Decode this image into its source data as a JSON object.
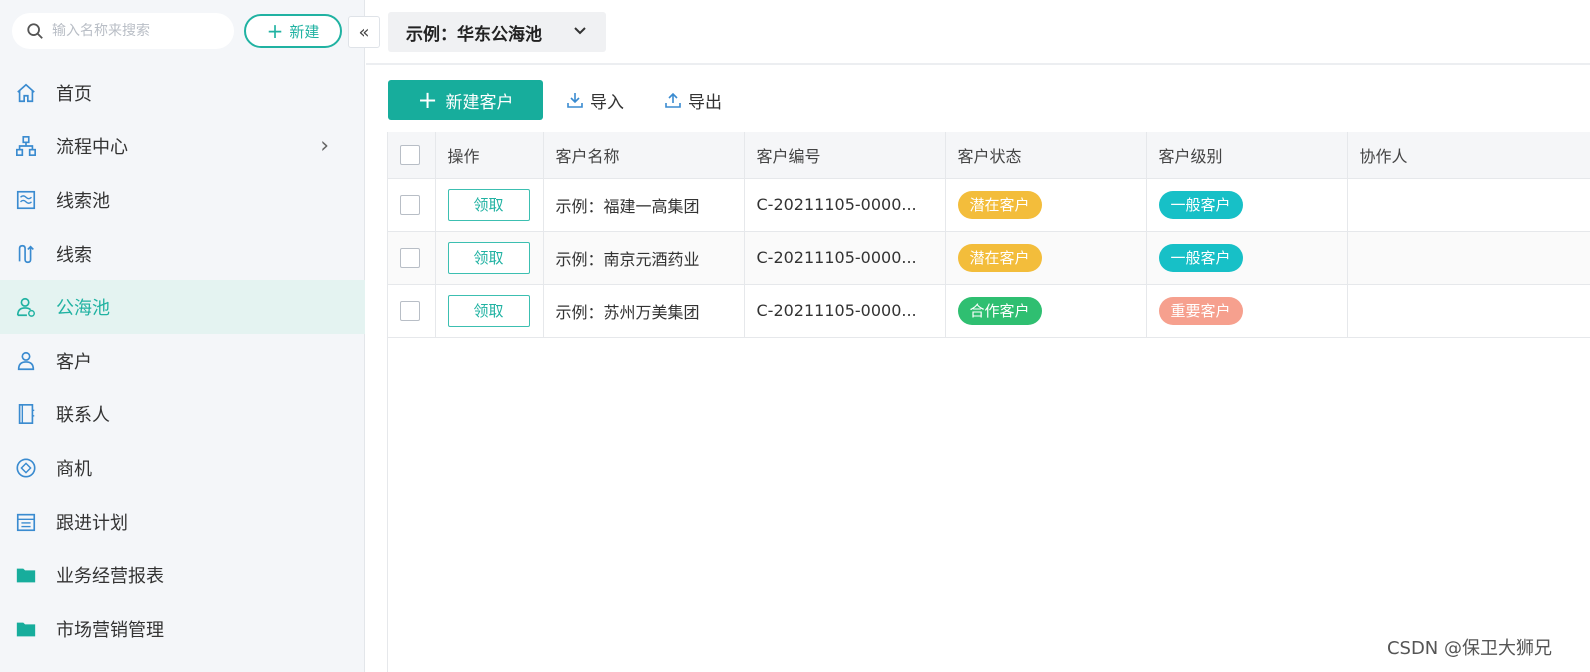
{
  "sidebar": {
    "search_placeholder": "输入名称来搜索",
    "new_button": "新建",
    "collapse_label": "«",
    "items": [
      {
        "label": "首页",
        "icon": "home-icon"
      },
      {
        "label": "流程中心",
        "icon": "flow-icon",
        "has_arrow": true
      },
      {
        "label": "线索池",
        "icon": "lead-pool-icon"
      },
      {
        "label": "线索",
        "icon": "lead-icon"
      },
      {
        "label": "公海池",
        "icon": "public-pool-icon",
        "active": true
      },
      {
        "label": "客户",
        "icon": "customer-icon"
      },
      {
        "label": "联系人",
        "icon": "contact-icon"
      },
      {
        "label": "商机",
        "icon": "opportunity-icon"
      },
      {
        "label": "跟进计划",
        "icon": "plan-icon"
      },
      {
        "label": "业务经营报表",
        "icon": "folder-icon"
      },
      {
        "label": "市场营销管理",
        "icon": "folder-icon"
      }
    ]
  },
  "topbar": {
    "pool_name": "示例：华东公海池"
  },
  "toolbar": {
    "add_customer": "新建客户",
    "import": "导入",
    "export": "导出"
  },
  "table": {
    "headers": [
      "操作",
      "客户名称",
      "客户编号",
      "客户状态",
      "客户级别",
      "协作人"
    ],
    "rows": [
      {
        "action": "领取",
        "name": "示例：福建一高集团",
        "code": "C-20211105-0000...",
        "status": "潜在客户",
        "level": "一般客户",
        "collaborator": ""
      },
      {
        "action": "领取",
        "name": "示例：南京元酒药业",
        "code": "C-20211105-0000...",
        "status": "潜在客户",
        "level": "一般客户",
        "collaborator": ""
      },
      {
        "action": "领取",
        "name": "示例：苏州万美集团",
        "code": "C-20211105-0000...",
        "status": "合作客户",
        "level": "重要客户",
        "collaborator": ""
      }
    ]
  },
  "colors": {
    "accent": "#17ad9c",
    "status_potential": "#f3bd3b",
    "status_cooperation": "#2fbf71",
    "level_normal": "#17c0c7",
    "level_important": "#f6a08e"
  },
  "watermark": "CSDN @保卫大狮兄"
}
